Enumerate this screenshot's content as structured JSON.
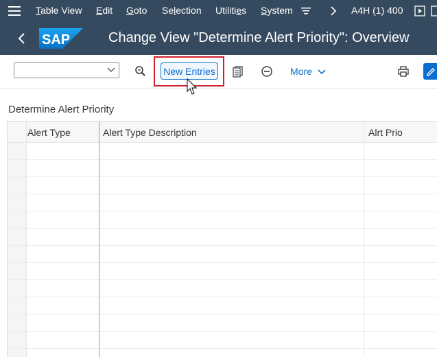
{
  "menubar": {
    "items": [
      {
        "label": "Table View",
        "underline": "T",
        "rest": "able View"
      },
      {
        "label": "Edit",
        "underline": "E",
        "rest": "dit"
      },
      {
        "label": "Goto",
        "underline": "G",
        "rest": "oto"
      },
      {
        "label": "Selection",
        "pre": "Se",
        "underline": "l",
        "rest": "ection"
      },
      {
        "label": "Utilities",
        "pre": "Utiliti",
        "underline": "e",
        "rest": "s"
      },
      {
        "label": "System",
        "underline": "S",
        "rest": "ystem"
      }
    ],
    "system_info": "A4H (1) 400"
  },
  "shell": {
    "logo": "SAP",
    "title": "Change View \"Determine Alert Priority\": Overview"
  },
  "toolbar": {
    "combo_value": "",
    "new_entries_label": "New Entries",
    "more_label": "More"
  },
  "content": {
    "section_title": "Determine Alert Priority",
    "columns": [
      "Alert Type",
      "Alert Type Description",
      "Alrt  Prio"
    ],
    "rows": []
  },
  "icons": {
    "menu": "hamburger-icon",
    "customize": "filter-lines-icon",
    "next": "chevron-right-icon",
    "play": "play-icon",
    "back": "back-chevron-icon",
    "search": "search-zoom-icon",
    "copy": "copy-entries-icon",
    "delete": "minus-circle-icon",
    "print": "printer-icon",
    "edit": "edit-icon"
  },
  "colors": {
    "shell": "#354a5f",
    "accent": "#0a6ed1",
    "highlight": "#d21f2e"
  }
}
